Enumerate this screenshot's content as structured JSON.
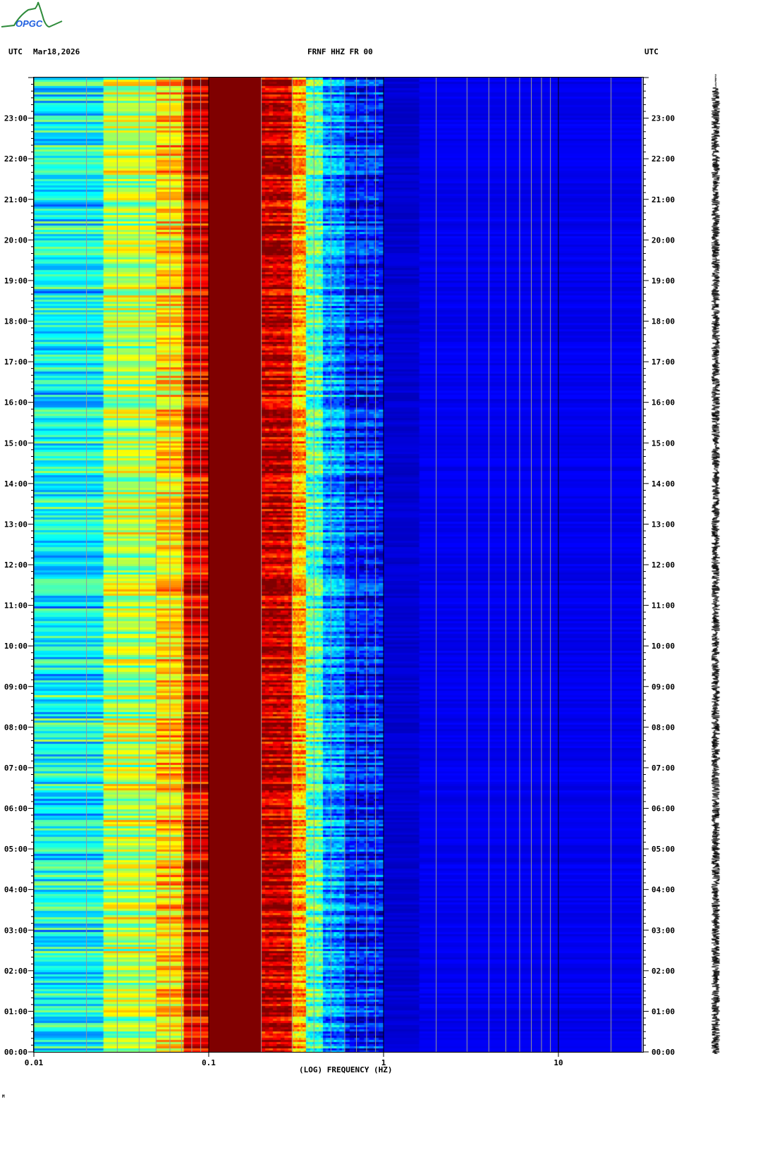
{
  "header": {
    "tz_left": "UTC",
    "date": "Mar18,2026",
    "station": "FRNF HHZ FR 00",
    "tz_right": "UTC"
  },
  "logo": {
    "text": "OPGC"
  },
  "footer": {
    "mark": "M"
  },
  "chart_data": {
    "type": "heatmap",
    "title": "FRNF HHZ FR 00",
    "xlabel": "(LOG) FREQUENCY (HZ)",
    "xscale": "log",
    "xlim": [
      0.01,
      30
    ],
    "xticks": [
      {
        "v": 0.01,
        "label": "0.01"
      },
      {
        "v": 0.1,
        "label": "0.1"
      },
      {
        "v": 1,
        "label": "1"
      },
      {
        "v": 10,
        "label": "10"
      }
    ],
    "ylabel": "UTC",
    "ylim_hours": [
      0,
      24
    ],
    "yticks": [
      "00:00",
      "01:00",
      "02:00",
      "03:00",
      "04:00",
      "05:00",
      "06:00",
      "07:00",
      "08:00",
      "09:00",
      "10:00",
      "11:00",
      "12:00",
      "13:00",
      "14:00",
      "15:00",
      "16:00",
      "17:00",
      "18:00",
      "19:00",
      "20:00",
      "21:00",
      "22:00",
      "23:00"
    ],
    "bands": [
      {
        "from": 0.01,
        "to": 0.025,
        "level": 0.38
      },
      {
        "from": 0.025,
        "to": 0.05,
        "level": 0.55
      },
      {
        "from": 0.05,
        "to": 0.072,
        "level": 0.66
      },
      {
        "from": 0.072,
        "to": 0.1,
        "level": 0.9
      },
      {
        "from": 0.1,
        "to": 0.2,
        "level": 1.0
      },
      {
        "from": 0.2,
        "to": 0.3,
        "level": 0.93
      },
      {
        "from": 0.3,
        "to": 0.36,
        "level": 0.7
      },
      {
        "from": 0.36,
        "to": 0.45,
        "level": 0.45
      },
      {
        "from": 0.45,
        "to": 0.6,
        "level": 0.28
      },
      {
        "from": 0.6,
        "to": 1.0,
        "level": 0.15
      },
      {
        "from": 1.0,
        "to": 1.6,
        "level": 0.08
      },
      {
        "from": 1.6,
        "to": 30,
        "level": 0.11
      }
    ],
    "colormap": "jet",
    "accent": {
      "lowest": "#00008f",
      "highest": "#800000"
    }
  }
}
